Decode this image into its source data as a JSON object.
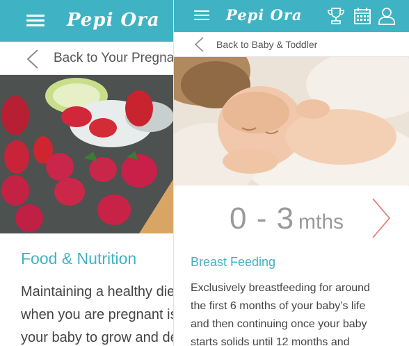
{
  "app": {
    "name": "Pepi Ora"
  },
  "left_screen": {
    "back_label": "Back to Your Pregnancy",
    "section_title": "Food & Nutrition",
    "body_lines": [
      "Maintaining a healthy diet",
      "when you are pregnant is",
      "your baby to grow and de"
    ]
  },
  "right_screen": {
    "back_label": "Back to Baby & Toddler",
    "age_range": "0 - 3",
    "age_unit": "mths",
    "section_title": "Breast Feeding",
    "body_lines": [
      "Exclusively breastfeeding for around",
      "the first 6 months of your baby’s life",
      "and then continuing once your baby",
      "starts solids until 12 months and"
    ],
    "toolbar_icons": [
      "trophy-icon",
      "calendar-icon",
      "user-icon"
    ]
  },
  "colors": {
    "brand": "#3fb3c3",
    "accent_chevron": "#e8837c",
    "text": "#444444",
    "muted_text": "#9a9a9a"
  }
}
